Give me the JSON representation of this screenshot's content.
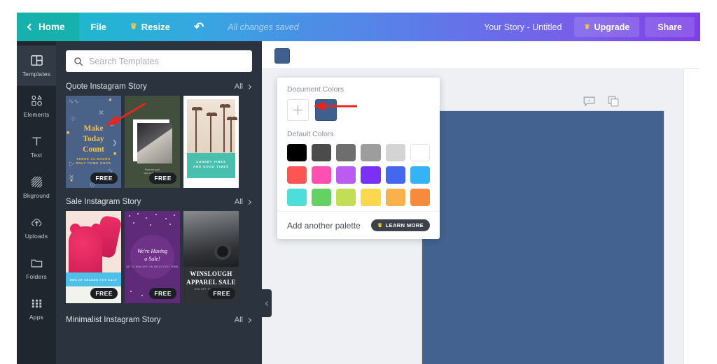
{
  "topbar": {
    "home_label": "Home",
    "file_label": "File",
    "resize_label": "Resize",
    "undo_icon": "undo-icon",
    "status_text": "All changes saved",
    "doc_title": "Your Story - Untitled",
    "upgrade_label": "Upgrade",
    "share_label": "Share"
  },
  "rail": {
    "items": [
      {
        "label": "Templates",
        "icon": "templates-icon",
        "active": true
      },
      {
        "label": "Elements",
        "icon": "elements-icon",
        "active": false
      },
      {
        "label": "Text",
        "icon": "text-icon",
        "active": false
      },
      {
        "label": "Bkground",
        "icon": "background-icon",
        "active": false
      },
      {
        "label": "Uploads",
        "icon": "uploads-icon",
        "active": false
      },
      {
        "label": "Folders",
        "icon": "folders-icon",
        "active": false
      },
      {
        "label": "Apps",
        "icon": "apps-icon",
        "active": false
      }
    ]
  },
  "panel": {
    "search_placeholder": "Search Templates",
    "search_value": "",
    "search_icon": "search-icon",
    "all_label": "All",
    "sections": [
      {
        "title": "Quote Instagram Story",
        "all_label": "All",
        "items": [
          {
            "badge": "FREE",
            "line1": "Make",
            "line2": "Today",
            "line3": "Count",
            "sub": "THREE 24 HOURS\nONLY COME ONCE"
          },
          {
            "badge": "FREE",
            "caption": "Pour out your\nsoul coffee first"
          },
          {
            "badge": "",
            "line1": "SUNSET VIBES",
            "line2": "AND GOOD TIMES"
          }
        ]
      },
      {
        "title": "Sale Instagram Story",
        "all_label": "All",
        "items": [
          {
            "badge": "FREE",
            "line1": "END OF SEASON TOY SALE"
          },
          {
            "badge": "FREE",
            "line1": "We're Having",
            "line2": "a Sale!",
            "sub": "UP TO 50% OFF ON SELECTED ITEMS"
          },
          {
            "badge": "FREE",
            "line1": "WINSLOUGH",
            "line2": "APPAREL SALE",
            "sub": "40% OFF ON ALL ITEMS"
          }
        ]
      },
      {
        "title": "Minimalist Instagram Story",
        "all_label": "All",
        "items": []
      }
    ],
    "collapse_icon": "chevron-left-icon"
  },
  "workspace": {
    "selected_color": "#3f5f8f",
    "canvas_color": "#43628f",
    "tools": [
      {
        "name": "comment-icon"
      },
      {
        "name": "duplicate-icon"
      }
    ]
  },
  "popover": {
    "document_colors_label": "Document Colors",
    "add_color_icon": "plus-icon",
    "document_colors": [
      "#3f5f8f"
    ],
    "default_colors_label": "Default Colors",
    "default_colors": [
      "#000000",
      "#4b4b4b",
      "#6e6e6e",
      "#9d9d9d",
      "#d4d4d4",
      "#ffffff",
      "#fd5454",
      "#ff4fb0",
      "#ba5cf0",
      "#7b30f5",
      "#4467f0",
      "#34b3f7",
      "#4fddd9",
      "#64d163",
      "#c2de56",
      "#fbd84d",
      "#f8b14b",
      "#f78a3c"
    ],
    "add_palette_label": "Add another palette",
    "learn_more_label": "LEARN MORE",
    "learn_more_icon": "crown-icon"
  },
  "annotations": {
    "color": "#e8241d",
    "arrows": [
      {
        "name": "arrow-to-document-color"
      },
      {
        "name": "arrow-to-template-thumbnail"
      }
    ]
  }
}
